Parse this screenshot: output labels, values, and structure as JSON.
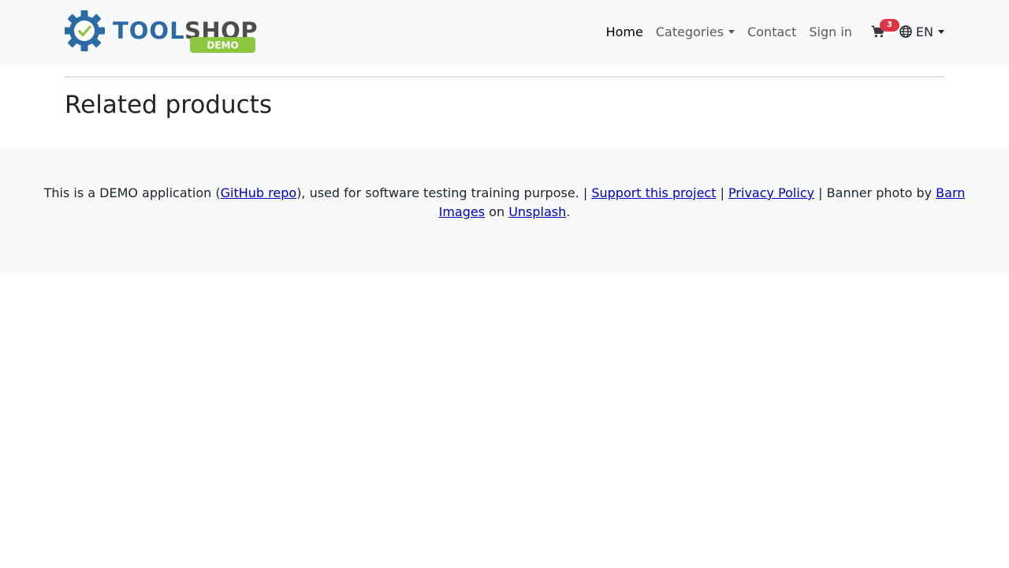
{
  "brand": {
    "logo_text_primary": "TOOL",
    "logo_text_secondary": "SHOP",
    "logo_badge": "DEMO",
    "colors": {
      "blue": "#2b6aa3",
      "gray": "#4d4d4f",
      "green": "#8dc63f"
    }
  },
  "nav": {
    "home": "Home",
    "categories": "Categories",
    "contact": "Contact",
    "sign_in": "Sign in",
    "cart_count": "3",
    "language": "EN",
    "icons": {
      "cart": "cart-icon",
      "language": "globe-icon"
    }
  },
  "main": {
    "section_title": "Related products"
  },
  "footer": {
    "text_1": "This is a DEMO application (",
    "github_link": "GitHub repo",
    "text_2": "), used for software testing training purpose. | ",
    "support_link": "Support this project",
    "sep_1": " | ",
    "privacy_link": "Privacy Policy",
    "text_3": " | Banner photo by ",
    "barn_link": "Barn Images",
    "text_4": " on ",
    "unsplash_link": "Unsplash",
    "text_5": "."
  },
  "colors": {
    "navbar_bg": "#f8f9fa",
    "badge": "#dc3545",
    "link": "#0000c0"
  }
}
